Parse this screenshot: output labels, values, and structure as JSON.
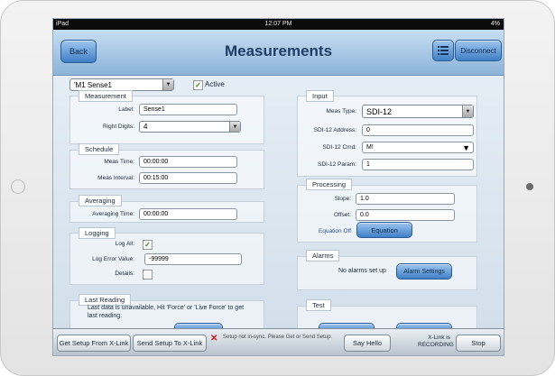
{
  "status_bar": {
    "carrier": "iPad",
    "time": "12:07 PM",
    "battery": "4%"
  },
  "navbar": {
    "back_label": "Back",
    "title": "Measurements",
    "list_icon": "list-icon",
    "disconnect_label": "Disconnect"
  },
  "top": {
    "measurement_select": "'M1 Sense1",
    "active_label": "Active",
    "active_checked": true
  },
  "measurement": {
    "header": "Measurement",
    "label_caption": "Label:",
    "label_value": "Sense1",
    "right_digits_caption": "Right Digits:",
    "right_digits_value": "4"
  },
  "schedule": {
    "header": "Schedule",
    "meas_time_caption": "Meas Time:",
    "meas_time_value": "00:00:00",
    "meas_interval_caption": "Meas Interval:",
    "meas_interval_value": "00:15:00"
  },
  "averaging": {
    "header": "Averaging",
    "averaging_time_caption": "Averaging Time:",
    "averaging_time_value": "00:00:00"
  },
  "logging": {
    "header": "Logging",
    "log_all_caption": "Log All:",
    "log_all_checked": true,
    "log_error_caption": "Log Error Value:",
    "log_error_value": "-99999",
    "details_caption": "Details:",
    "details_checked": false
  },
  "last_reading": {
    "header": "Last Reading",
    "message": "Last data is unavailable, Hit 'Force' or 'Live Force' to get last reading."
  },
  "input": {
    "header": "Input",
    "meas_type_caption": "Meas Type:",
    "meas_type_value": "SDI-12",
    "address_caption": "SDI-12 Address:",
    "address_value": "0",
    "cmd_caption": "SDI-12 Cmd:",
    "cmd_value": "M!",
    "param_caption": "SDI-12 Param:",
    "param_value": "1"
  },
  "processing": {
    "header": "Processing",
    "slope_caption": "Slope:",
    "slope_value": "1.0",
    "offset_caption": "Offset:",
    "offset_value": "0.0",
    "equation_status": "Equation Off",
    "equation_label": "Equation"
  },
  "alarms": {
    "header": "Alarms",
    "message": "No alarms set up",
    "settings_label": "Alarm Settings"
  },
  "test": {
    "header": "Test"
  },
  "toolbar": {
    "get_setup_label": "Get Setup From X-Link",
    "send_setup_label": "Send Setup To X-Link",
    "warning_icon": "x-icon",
    "warning_text": "Setup not in-sync. Please Get or Send Setup.",
    "say_hello_label": "Say Hello",
    "recording_status": "X-Link is RECORDING",
    "stop_label": "Stop"
  }
}
